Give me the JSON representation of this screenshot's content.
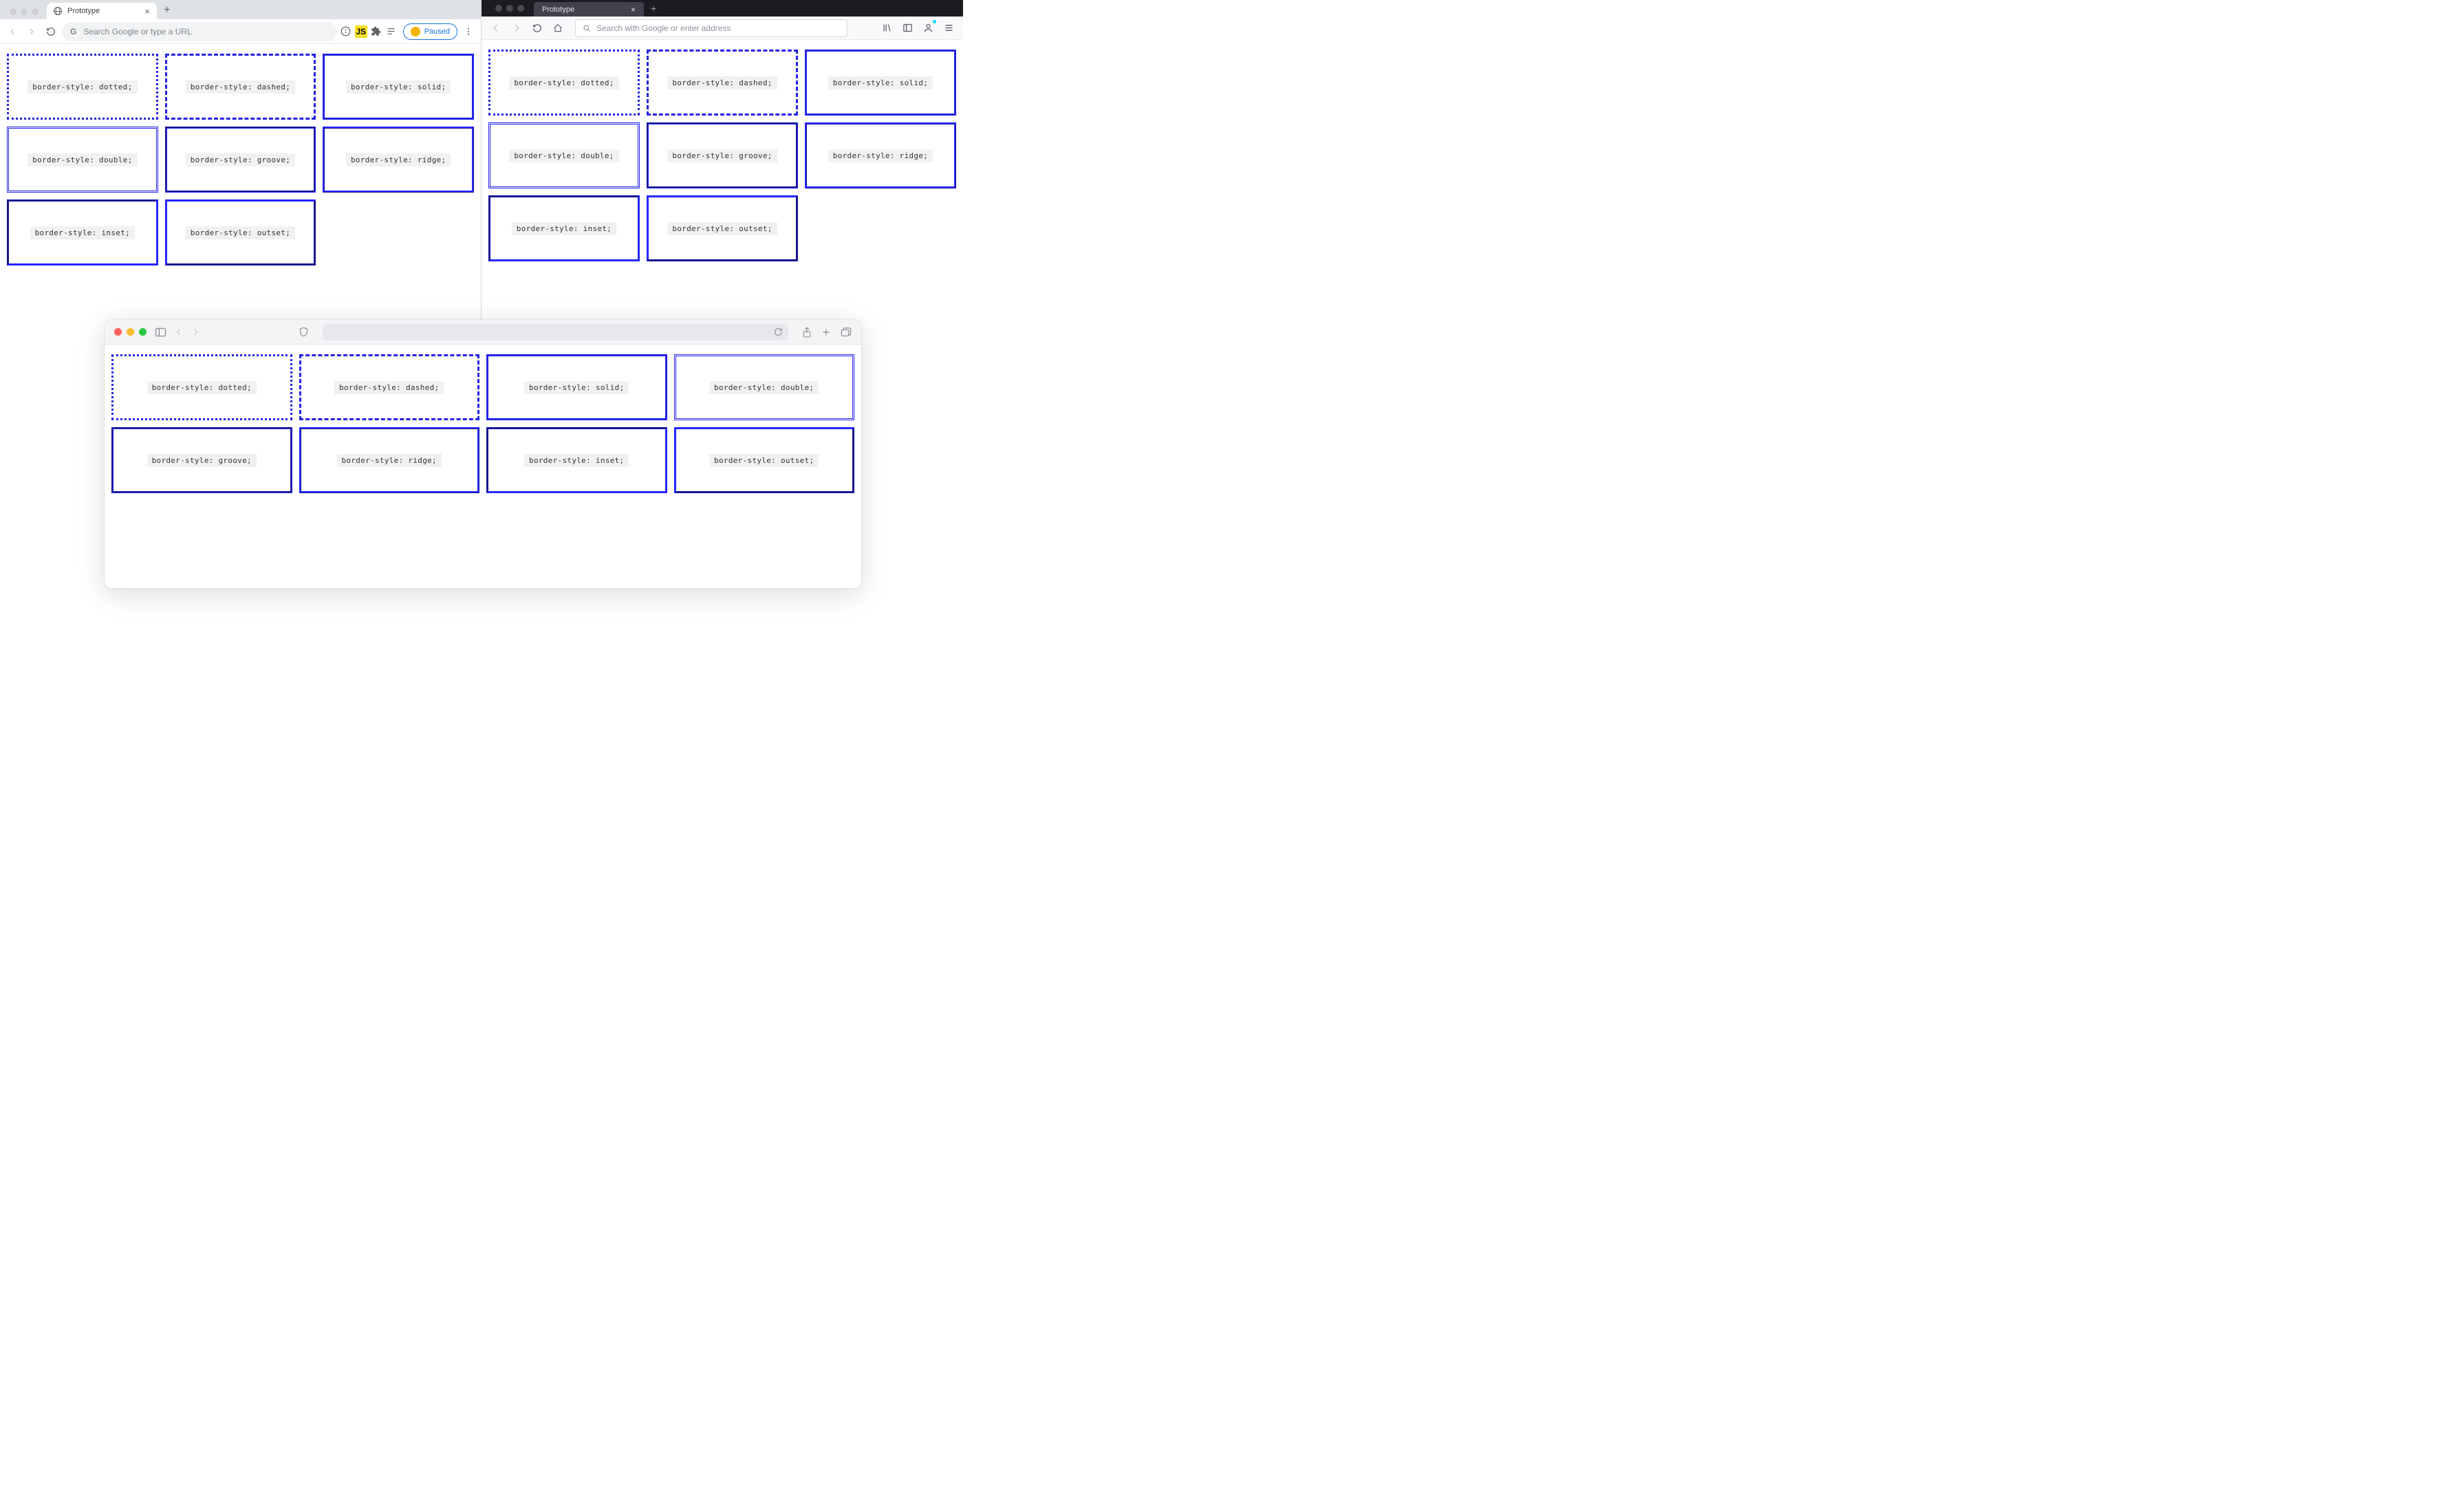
{
  "colors": {
    "border": "#2323e6",
    "chrome_tabbar": "#dee1e6",
    "chrome_omnibox": "#f1f3f4",
    "firefox_tabbar": "#1c1b22",
    "safari_toolbar": "#f4f3f6"
  },
  "border_styles": [
    "dotted",
    "dashed",
    "solid",
    "double",
    "groove",
    "ridge",
    "inset",
    "outset"
  ],
  "chrome": {
    "tab_title": "Prototype",
    "omnibox_placeholder": "Search Google or type a URL",
    "profile_label": "Paused",
    "boxes": [
      "border-style: dotted;",
      "border-style: dashed;",
      "border-style: solid;",
      "border-style: double;",
      "border-style: groove;",
      "border-style: ridge;",
      "border-style: inset;",
      "border-style: outset;"
    ]
  },
  "firefox": {
    "tab_title": "Prototype",
    "omnibox_placeholder": "Search with Google or enter address",
    "boxes": [
      "border-style: dotted;",
      "border-style: dashed;",
      "border-style: solid;",
      "border-style: double;",
      "border-style: groove;",
      "border-style: ridge;",
      "border-style: inset;",
      "border-style: outset;"
    ]
  },
  "safari": {
    "boxes": [
      "border-style: dotted;",
      "border-style: dashed;",
      "border-style: solid;",
      "border-style: double;",
      "border-style: groove;",
      "border-style: ridge;",
      "border-style: inset;",
      "border-style: outset;"
    ]
  }
}
